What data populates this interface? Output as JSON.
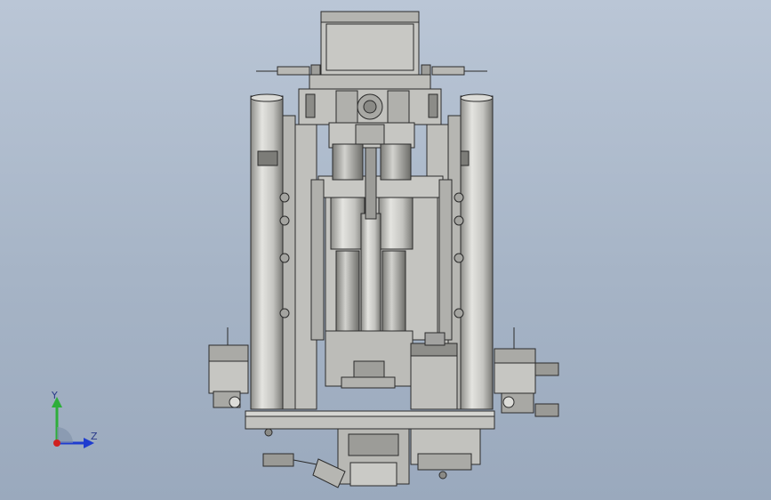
{
  "viewport": {
    "background_top": "#bac6d6",
    "background_bottom": "#9aa9bd"
  },
  "model": {
    "body_color": "#c4c4c0",
    "shade_color": "#a9a9a5",
    "dark_color": "#6e6e6a",
    "edge_color": "#2b2b2b"
  },
  "triad": {
    "y_label": "Y",
    "z_label": "Z",
    "y_color": "#2eae3a",
    "z_color": "#1f3ccf",
    "x_color": "#d02020"
  }
}
